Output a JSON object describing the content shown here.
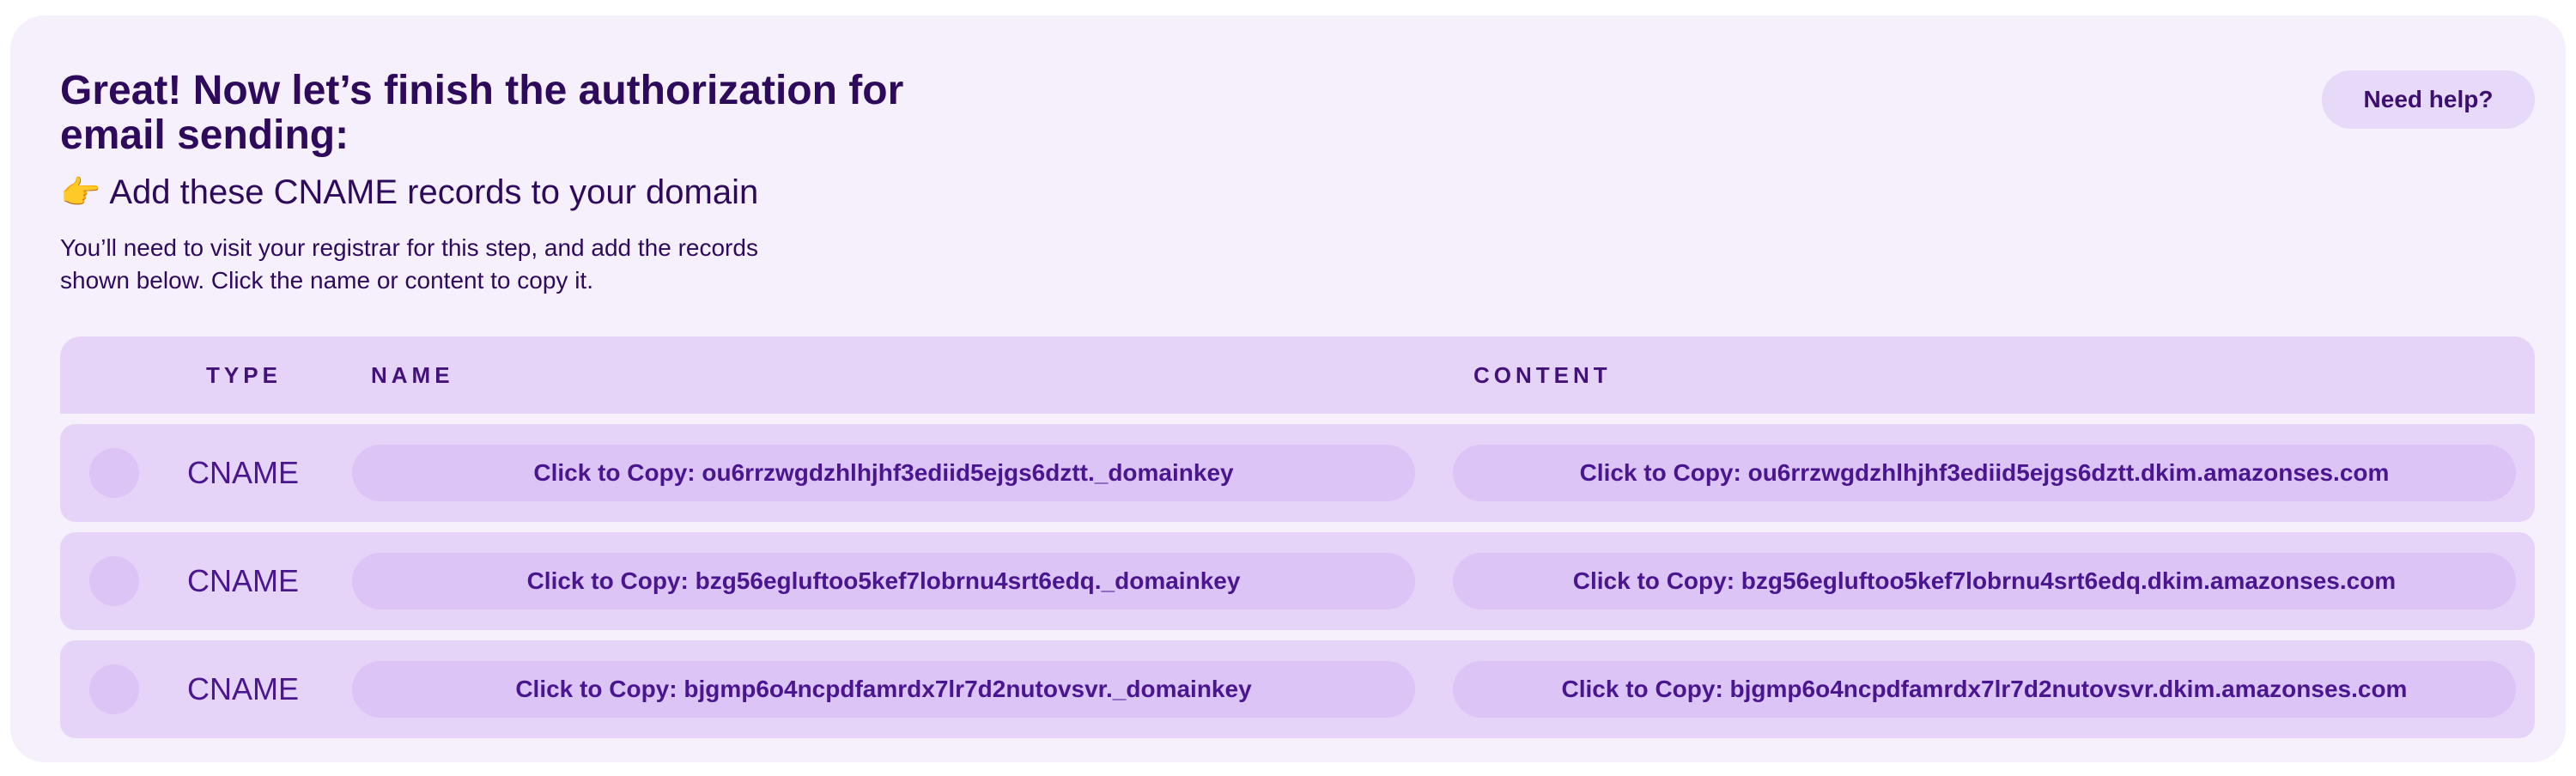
{
  "header": {
    "title": "Great! Now let’s finish the authorization for email sending:",
    "help_label": "Need help?"
  },
  "step": {
    "icon": "pointing-hand-icon",
    "icon_glyph": "👉",
    "title": "Add these CNAME records to your domain",
    "description": "You’ll need to visit your registrar for this step, and add the records shown below. Click the name or content to copy it."
  },
  "table": {
    "columns": {
      "type": "TYPE",
      "name": "NAME",
      "content": "CONTENT"
    },
    "rows": [
      {
        "type": "CNAME",
        "name": "Click to Copy: ou6rrzwgdzhlhjhf3ediid5ejgs6dztt._domainkey",
        "content": "Click to Copy: ou6rrzwgdzhlhjhf3ediid5ejgs6dztt.dkim.amazonses.com"
      },
      {
        "type": "CNAME",
        "name": "Click to Copy: bzg56egluftoo5kef7lobrnu4srt6edq._domainkey",
        "content": "Click to Copy: bzg56egluftoo5kef7lobrnu4srt6edq.dkim.amazonses.com"
      },
      {
        "type": "CNAME",
        "name": "Click to Copy: bjgmp6o4ncpdfamrdx7lr7d2nutovsvr._domainkey",
        "content": "Click to Copy: bjgmp6o4ncpdfamrdx7lr7d2nutovsvr.dkim.amazonses.com"
      }
    ]
  },
  "colors": {
    "card_background": "#f5f0fc",
    "table_background": "#e6d4f8",
    "pill_background": "#dcc4f6",
    "text": "#2e0a5c",
    "accent_text": "#4a1690"
  }
}
